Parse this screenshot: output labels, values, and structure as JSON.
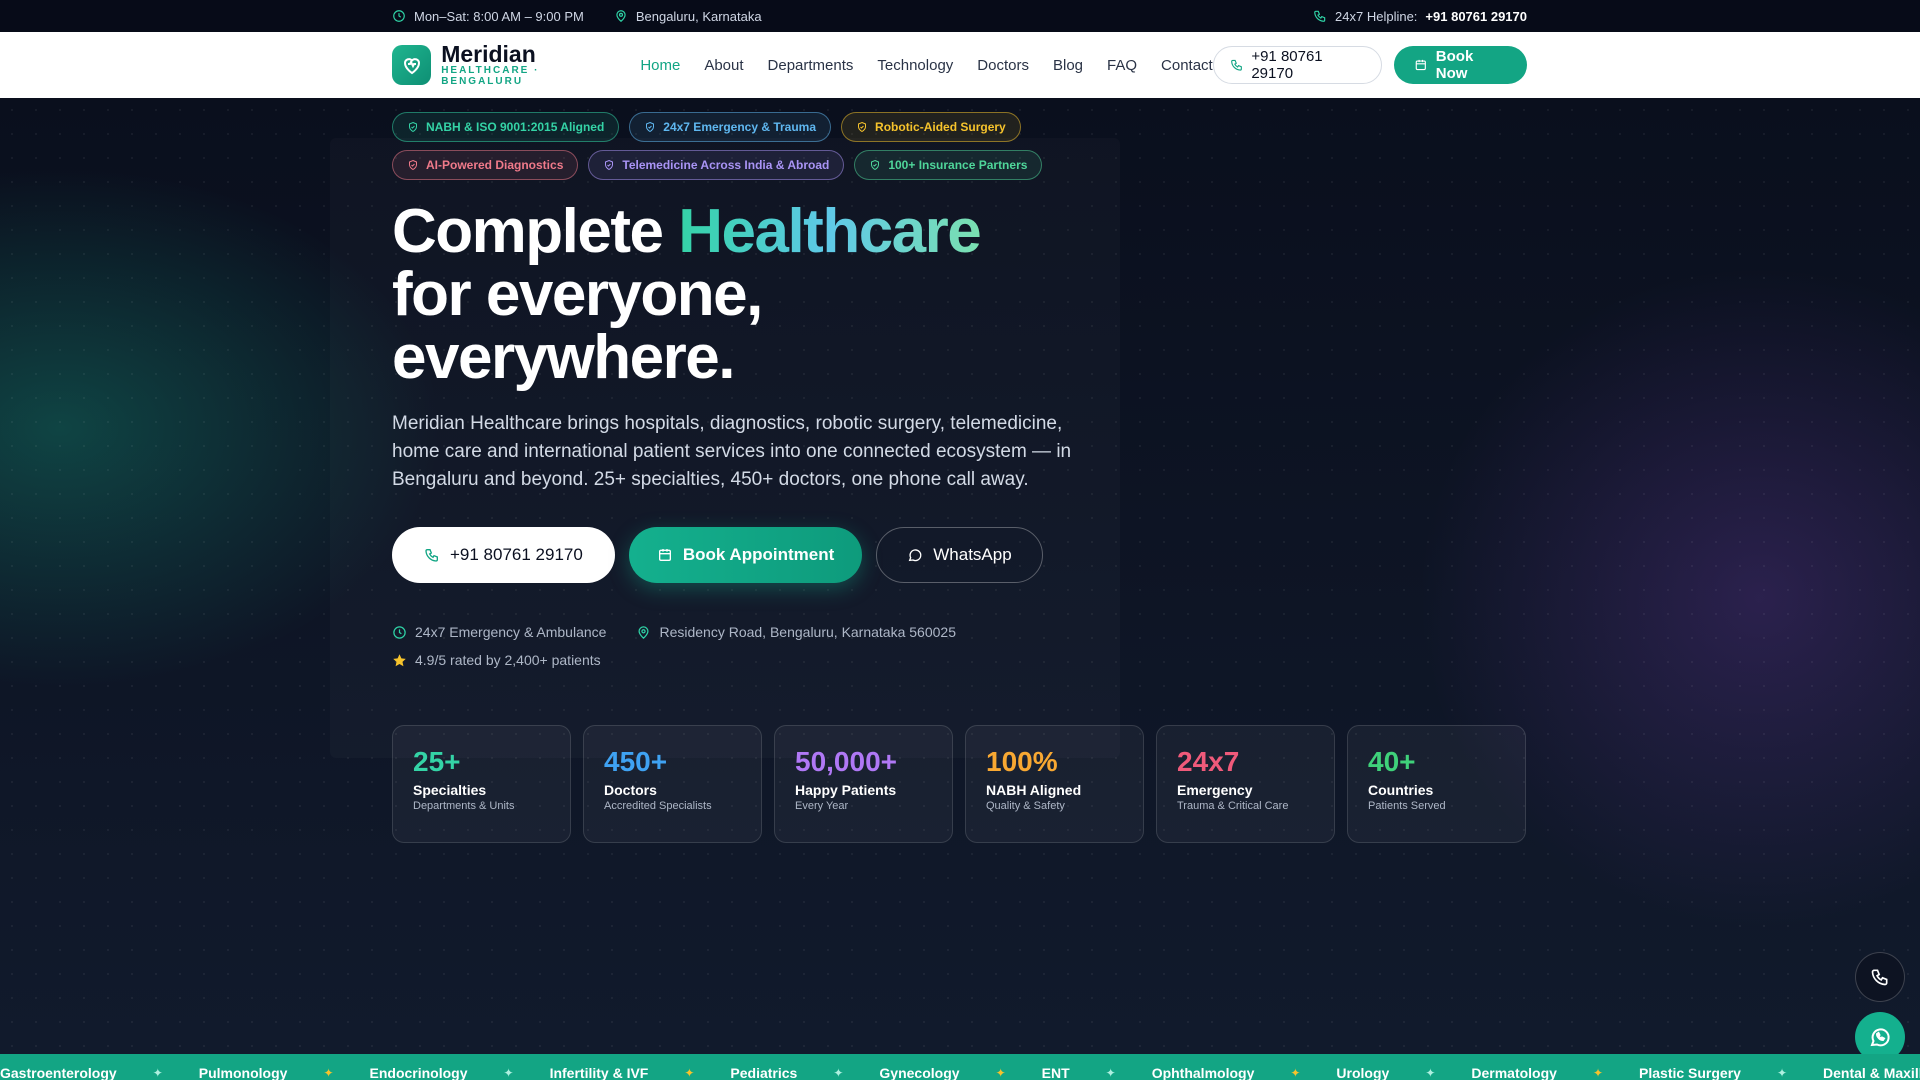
{
  "topbar": {
    "hours": "Mon–Sat: 8:00 AM – 9:00 PM",
    "location": "Bengaluru, Karnataka",
    "helpline_label": "24x7 Helpline:",
    "helpline_number": "+91 80761 29170"
  },
  "brand": {
    "name": "Meridian",
    "tagline": "HEALTHCARE · BENGALURU",
    "accent": "#13a584"
  },
  "nav": {
    "items": [
      "Home",
      "About",
      "Departments",
      "Technology",
      "Doctors",
      "Blog",
      "FAQ",
      "Contact"
    ],
    "phone": "+91 80761 29170",
    "book": "Book Now"
  },
  "badges": [
    {
      "label": "NABH & ISO 9001:2015 Aligned",
      "color": "#34d3a6"
    },
    {
      "label": "24x7 Emergency & Trauma",
      "color": "#5fb7f0"
    },
    {
      "label": "Robotic-Aided Surgery",
      "color": "#f6c32c"
    },
    {
      "label": "AI-Powered Diagnostics",
      "color": "#f07a8a"
    },
    {
      "label": "Telemedicine Across India & Abroad",
      "color": "#a994f5"
    },
    {
      "label": "100+ Insurance Partners",
      "color": "#4fd69a"
    }
  ],
  "hero": {
    "headline_1": "Complete ",
    "headline_accent": "Healthcare",
    "headline_2": "for everyone,",
    "headline_3": "everywhere.",
    "description": "Meridian Healthcare brings hospitals, diagnostics, robotic surgery, telemedicine, home care and international patient services into one connected ecosystem — in Bengaluru and beyond. 25+ specialties, 450+ doctors, one phone call away.",
    "cta_phone": "+91 80761 29170",
    "cta_book": "Book Appointment",
    "cta_whatsapp": "WhatsApp",
    "meta_emergency": "24x7 Emergency & Ambulance",
    "meta_address": "Residency Road, Bengaluru, Karnataka 560025",
    "meta_rating": "4.9/5 rated by 2,400+ patients"
  },
  "stats": [
    {
      "value": "25+",
      "label": "Specialties",
      "sub": "Departments & Units",
      "color": "#34d3a6"
    },
    {
      "value": "450+",
      "label": "Doctors",
      "sub": "Accredited Specialists",
      "color": "#3fa2f2"
    },
    {
      "value": "50,000+",
      "label": "Happy Patients",
      "sub": "Every Year",
      "color": "#b078f5"
    },
    {
      "value": "100%",
      "label": "NABH Aligned",
      "sub": "Quality & Safety",
      "color": "#f8a832"
    },
    {
      "value": "24x7",
      "label": "Emergency",
      "sub": "Trauma & Critical Care",
      "color": "#f05a7a"
    },
    {
      "value": "40+",
      "label": "Countries",
      "sub": "Patients Served",
      "color": "#3fd17a"
    }
  ],
  "marquee": {
    "items": [
      "Gastroenterology",
      "Pulmonology",
      "Endocrinology",
      "Infertility & IVF",
      "Pediatrics",
      "Gynecology",
      "ENT",
      "Ophthalmology",
      "Urology",
      "Dermatology",
      "Plastic Surgery",
      "Dental & Maxillofacial"
    ],
    "separator": "✦"
  }
}
